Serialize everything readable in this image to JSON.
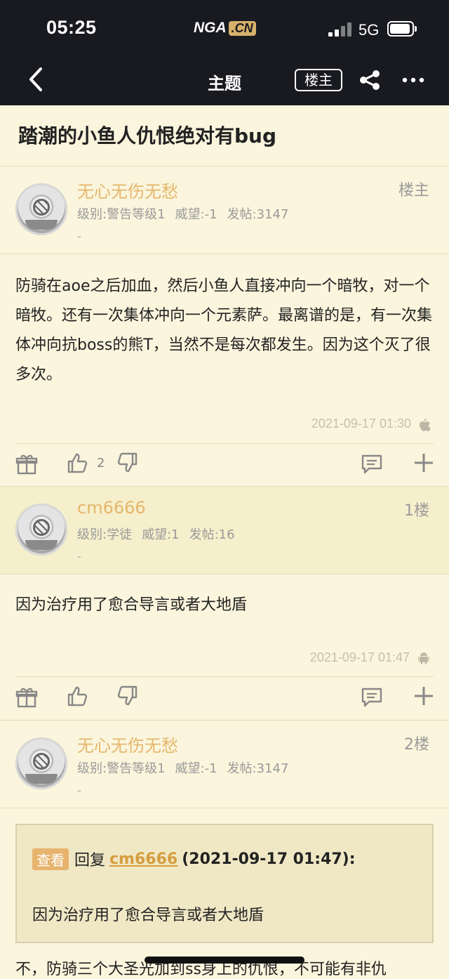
{
  "status_bar": {
    "time": "05:25",
    "logo_main": "NGA",
    "logo_badge": ".CN",
    "network": "5G"
  },
  "nav": {
    "title": "主题",
    "owner_button": "楼主"
  },
  "thread": {
    "title": "踏潮的小鱼人仇恨绝对有bug"
  },
  "posts": [
    {
      "username": "无心无伤无愁",
      "floor": "楼主",
      "level": "级别:警告等级1",
      "reputation": "威望:-1",
      "post_count": "发帖:3147",
      "signature": "-",
      "content": "防骑在aoe之后加血，然后小鱼人直接冲向一个暗牧，对一个暗牧。还有一次集体冲向一个元素萨。最离谱的是，有一次集体冲向抗boss的熊T，当然不是每次都发生。因为这个灭了很多次。",
      "timestamp": "2021-09-17 01:30",
      "device_icon": "apple-icon",
      "likes": "2"
    },
    {
      "username": "cm6666",
      "floor": "1楼",
      "level": "级别:学徒",
      "reputation": "威望:1",
      "post_count": "发帖:16",
      "signature": "-",
      "content": "因为治疗用了愈合导言或者大地盾",
      "timestamp": "2021-09-17 01:47",
      "device_icon": "android-icon",
      "likes": ""
    },
    {
      "username": "无心无伤无愁",
      "floor": "2楼",
      "level": "级别:警告等级1",
      "reputation": "威望:-1",
      "post_count": "发帖:3147",
      "signature": "-",
      "quote": {
        "view_tag": "查看",
        "reply_prefix": "回复",
        "reply_user": "cm6666",
        "reply_time": "(2021-09-17 01:47):",
        "text": "因为治疗用了愈合导言或者大地盾"
      },
      "content_partial": "不，防骑三个大圣光加到ss身上的仇恨，不可能有非仇"
    }
  ],
  "colors": {
    "topbar": "#191a20",
    "background": "#fbf5dd",
    "username": "#e4b76c",
    "link": "#d59d3f"
  }
}
